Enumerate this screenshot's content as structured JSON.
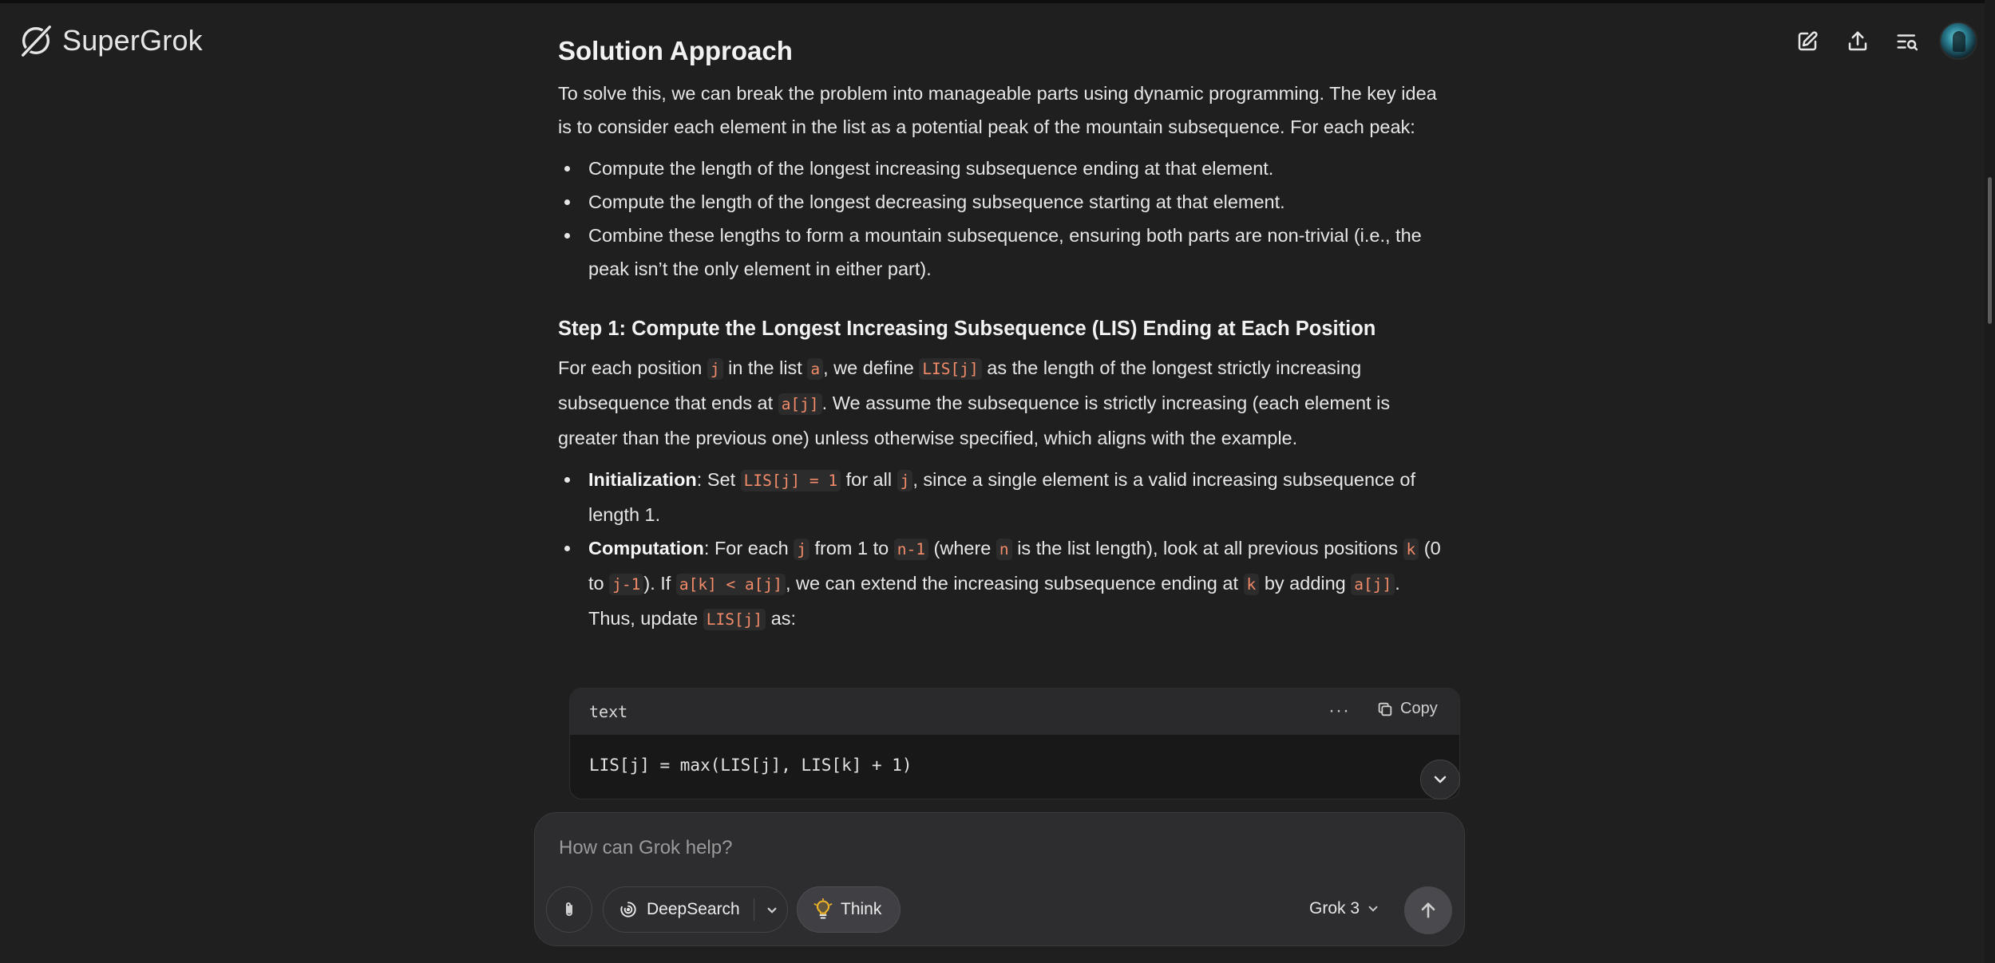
{
  "app": {
    "name": "SuperGrok"
  },
  "header": {
    "icons": [
      "new-chat-icon",
      "share-icon",
      "history-search-icon",
      "avatar"
    ]
  },
  "content": {
    "heading": "Solution Approach",
    "intro": "To solve this, we can break the problem into manageable parts using dynamic programming. The key idea is to consider each element in the list as a potential peak of the mountain subsequence. For each peak:",
    "bullets": [
      "Compute the length of the longest increasing subsequence ending at that element.",
      "Compute the length of the longest decreasing subsequence starting at that element.",
      "Combine these lengths to form a mountain subsequence, ensuring both parts are non-trivial (i.e., the peak isn’t the only element in either part)."
    ],
    "step1": {
      "heading": "Step 1: Compute the Longest Increasing Subsequence (LIS) Ending at Each Position",
      "p1": "For each position",
      "c_j": "j",
      "p2": "in the list",
      "c_a": "a",
      "p3": ", we define",
      "c_lisj": "LIS[j]",
      "p4": "as the length of the longest strictly increasing subsequence that ends at",
      "c_aj": "a[j]",
      "p5": ". We assume the subsequence is strictly increasing (each element is greater than the previous one) unless otherwise specified, which aligns with the example.",
      "init": {
        "label": "Initialization",
        "t1": ": Set",
        "c1": "LIS[j] = 1",
        "t2": "for all",
        "c2": "j",
        "t3": ", since a single element is a valid increasing subsequence of length 1."
      },
      "comp": {
        "label": "Computation",
        "t1": ": For each",
        "c1": "j",
        "t2": "from 1 to",
        "c2": "n-1",
        "t3": "(where",
        "c3": "n",
        "t4": "is the list length), look at all previous positions",
        "c4": "k",
        "t5": "(0 to",
        "c5": "j-1",
        "t6": "). If",
        "c6": "a[k] < a[j]",
        "t7": ", we can extend the increasing subsequence ending at",
        "c7": "k",
        "t8": "by adding",
        "c8": "a[j]",
        "t9": ". Thus, update",
        "c9": "LIS[j]",
        "t10": "as:"
      }
    },
    "codeblock": {
      "language": "text",
      "copy_label": "Copy",
      "more_label": "···",
      "code": "LIS[j] = max(LIS[j], LIS[k] + 1)"
    }
  },
  "composer": {
    "placeholder": "How can Grok help?",
    "deepsearch_label": "DeepSearch",
    "think_label": "Think",
    "model_label": "Grok 3"
  }
}
